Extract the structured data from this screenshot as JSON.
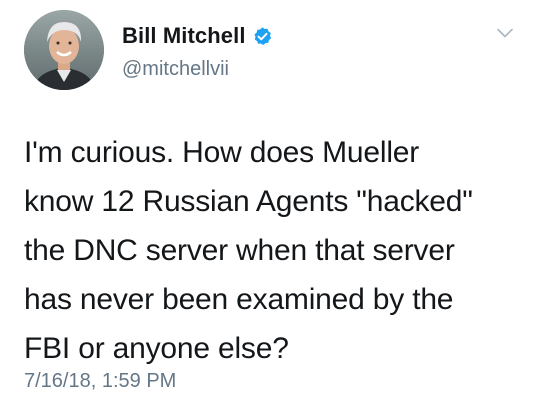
{
  "user": {
    "display_name": "Bill Mitchell",
    "handle": "@mitchellvii",
    "verified": true,
    "avatar_icon": "avatar-photo"
  },
  "tweet": {
    "text": "I'm curious.  How does Mueller\nknow 12 Russian Agents \"hacked\"\nthe DNC server when that server\nhas never been examined by the\nFBI or anyone else?",
    "timestamp": "7/16/18, 1:59 PM"
  },
  "icons": {
    "verified": "verified-badge-icon",
    "menu": "chevron-down-icon"
  },
  "colors": {
    "verified_blue": "#1da1f2",
    "text_primary": "#14171a",
    "text_secondary": "#657786"
  }
}
